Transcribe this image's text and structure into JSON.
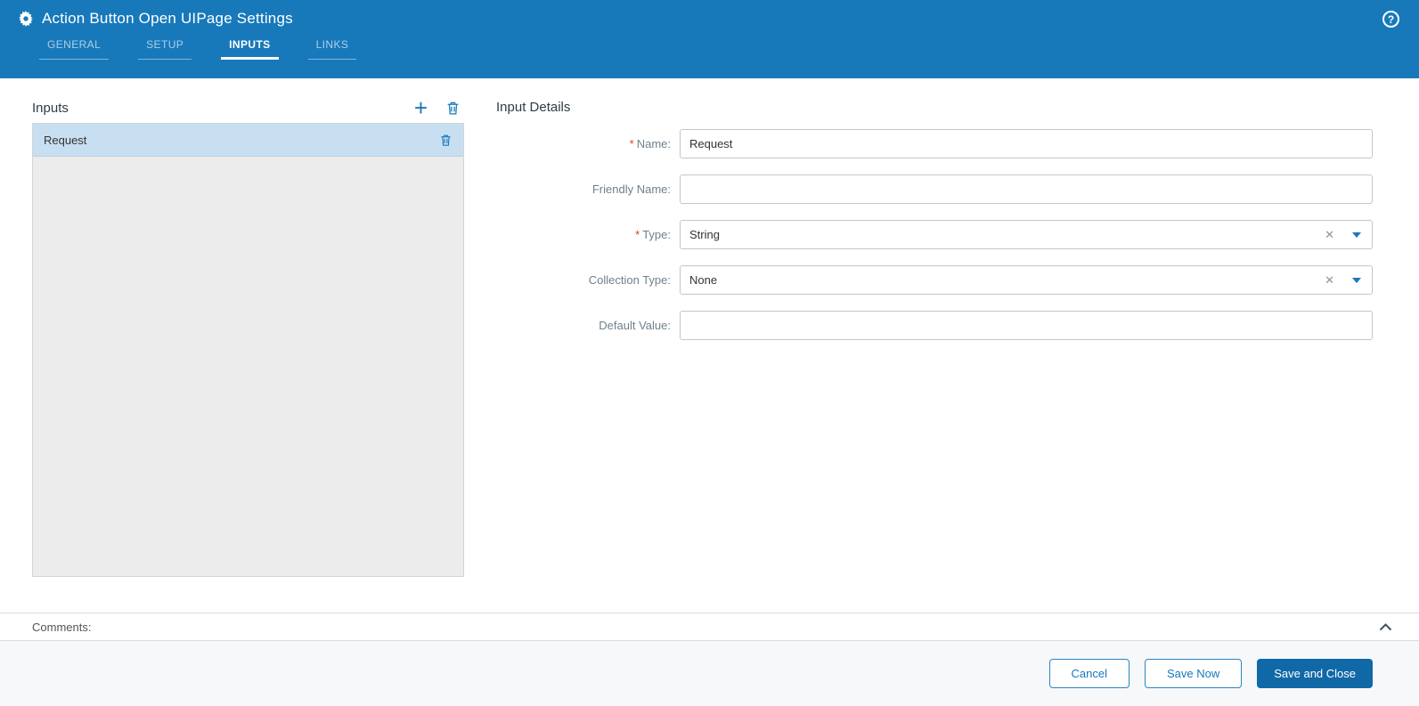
{
  "colors": {
    "header_bg": "#1779ba",
    "accent": "#1779ba",
    "selected_row_bg": "#c8dff2",
    "list_bg": "#ececec",
    "primary_button_bg": "#1168a7",
    "required_color": "#d9480f"
  },
  "header": {
    "title": "Action Button Open UIPage Settings",
    "tabs": [
      {
        "label": "GENERAL",
        "active": false
      },
      {
        "label": "SETUP",
        "active": false
      },
      {
        "label": "INPUTS",
        "active": true
      },
      {
        "label": "LINKS",
        "active": false
      }
    ]
  },
  "icons": {
    "plus": "+",
    "clear": "✕",
    "help": "?"
  },
  "inputs_panel": {
    "title": "Inputs",
    "items": [
      {
        "label": "Request",
        "selected": true
      }
    ]
  },
  "details": {
    "title": "Input Details",
    "required_mark": "*",
    "fields": {
      "name": {
        "label": "Name:",
        "value": "Request",
        "required": true
      },
      "friendly_name": {
        "label": "Friendly Name:",
        "value": "",
        "required": false
      },
      "type": {
        "label": "Type:",
        "value": "String",
        "required": true
      },
      "collection_type": {
        "label": "Collection Type:",
        "value": "None",
        "required": false
      },
      "default_value": {
        "label": "Default Value:",
        "value": "",
        "required": false
      }
    }
  },
  "comments": {
    "label": "Comments:"
  },
  "footer": {
    "cancel_label": "Cancel",
    "save_now_label": "Save Now",
    "save_and_close_label": "Save and Close"
  }
}
